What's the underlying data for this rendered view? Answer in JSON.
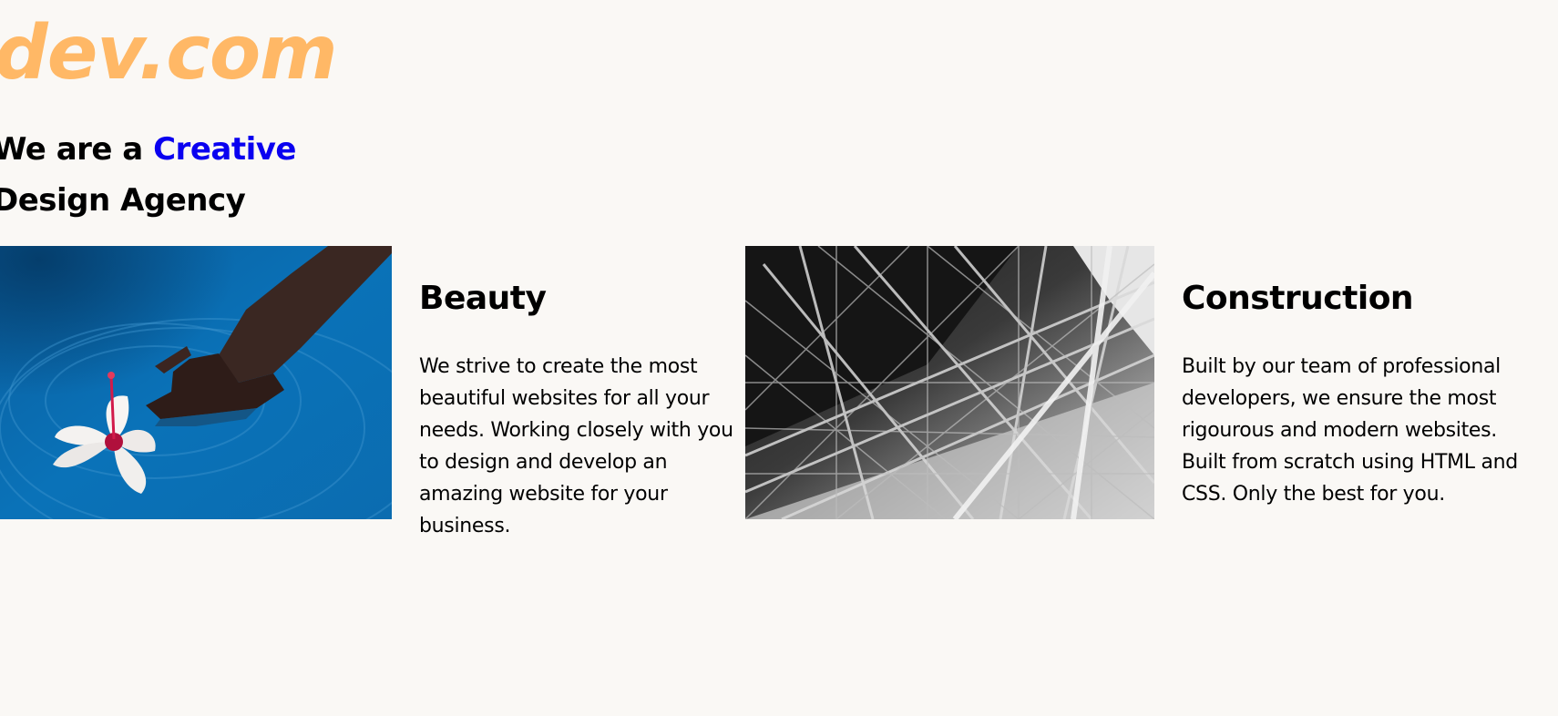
{
  "logo": {
    "text": "dev.com"
  },
  "headline": {
    "line1_prefix": "We are a",
    "line1_accent": "Creative",
    "line2": "Design Agency"
  },
  "cards": [
    {
      "title": "Beauty",
      "text": "We strive to create the most beautiful websites for all your needs. Working closely with you to design and develop an amazing website for your business."
    },
    {
      "title": "Construction",
      "text": "Built by our team of professional developers, we ensure the most rigourous and modern websites. Built from scratch using HTML and CSS. Only the best for you."
    }
  ],
  "colors": {
    "background": "#faf8f5",
    "logo": "#ffb866",
    "accent": "#0a00f0",
    "water": "#0a6fb4"
  },
  "images": [
    {
      "name": "hand-with-flower-in-water-image"
    },
    {
      "name": "steel-structure-image"
    }
  ]
}
